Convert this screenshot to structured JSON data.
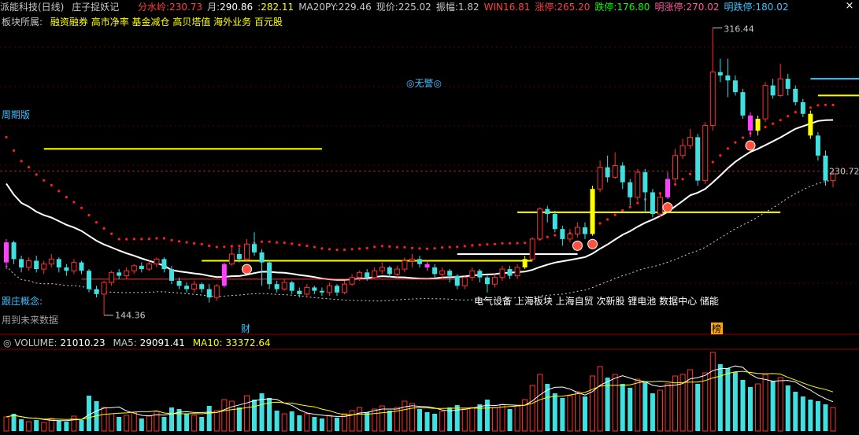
{
  "header": {
    "title": "派能科技(日线)",
    "indicator_name": "庄子捉妖记",
    "fields": [
      {
        "label": "分水岭:",
        "value": "230.73",
        "label_color": "#ff4040",
        "value_color": "#ff4040"
      },
      {
        "label": "月:",
        "value": "290.86",
        "label_color": "#c8c8c8",
        "value_color": "#ffffff"
      },
      {
        "label": ":",
        "value": "282.11",
        "label_color": "#c8c8c8",
        "value_color": "#ffff00"
      },
      {
        "label": "MA20PY:",
        "value": "229.46",
        "label_color": "#c8c8c8",
        "value_color": "#c8c8c8"
      },
      {
        "label": "现价:",
        "value": "225.02",
        "label_color": "#c8c8c8",
        "value_color": "#c8c8c8"
      },
      {
        "label": "振幅:",
        "value": "1.82",
        "label_color": "#c8c8c8",
        "value_color": "#c8c8c8"
      },
      {
        "label": "WIN",
        "value": "16.81",
        "label_color": "#ff4040",
        "value_color": "#ff4040"
      },
      {
        "label": "涨停:",
        "value": "265.20",
        "label_color": "#ff4040",
        "value_color": "#ff4040"
      },
      {
        "label": "跌停:",
        "value": "176.80",
        "label_color": "#00ff00",
        "value_color": "#00ff00"
      },
      {
        "label": "明涨停:",
        "value": "270.02",
        "label_color": "#ff5aa0",
        "value_color": "#ff5aa0"
      },
      {
        "label": "明跌停:",
        "value": "180.02",
        "label_color": "#40c0ff",
        "value_color": "#40c0ff"
      }
    ],
    "close_symbol": "×"
  },
  "boards": {
    "key": "板块所属:",
    "value": "融资融券 高市净率 基金减仓 高贝塔值 海外业务 百元股"
  },
  "side_labels": {
    "zhouqi": "周期版",
    "gen": "跟庄概念:",
    "future": "用到未来数据"
  },
  "alarm": "◎无警◎",
  "concepts": "电气设备 上海板块 上海自贸 次新股 锂电池 数据中心 储能",
  "markers": {
    "cai": "财",
    "bang": "榜"
  },
  "chart_data": {
    "type": "candlestick",
    "annotations": {
      "high_label": "316.44",
      "low_label": "144.36",
      "right_label": "230.72"
    },
    "volume": {
      "label": "VOLUME:",
      "value": "21010.23",
      "ma5_label": "MA5:",
      "ma5": "29091.41",
      "ma10_label": "MA10:",
      "ma10": "33372.64"
    },
    "candles": [
      {
        "o": 176,
        "c": 188,
        "h": 190,
        "l": 172
      },
      {
        "o": 188,
        "c": 178,
        "h": 189,
        "l": 175
      },
      {
        "o": 178,
        "c": 173,
        "h": 180,
        "l": 170
      },
      {
        "o": 173,
        "c": 177,
        "h": 179,
        "l": 171
      },
      {
        "o": 177,
        "c": 172,
        "h": 180,
        "l": 170
      },
      {
        "o": 172,
        "c": 175,
        "h": 177,
        "l": 169
      },
      {
        "o": 175,
        "c": 178,
        "h": 181,
        "l": 173
      },
      {
        "o": 178,
        "c": 173,
        "h": 179,
        "l": 170
      },
      {
        "o": 173,
        "c": 171,
        "h": 175,
        "l": 168
      },
      {
        "o": 171,
        "c": 176,
        "h": 178,
        "l": 169
      },
      {
        "o": 176,
        "c": 171,
        "h": 177,
        "l": 169
      },
      {
        "o": 171,
        "c": 160,
        "h": 172,
        "l": 158
      },
      {
        "o": 160,
        "c": 157,
        "h": 162,
        "l": 155
      },
      {
        "o": 157,
        "c": 164,
        "h": 165,
        "l": 144.36
      },
      {
        "o": 164,
        "c": 170,
        "h": 171,
        "l": 162
      },
      {
        "o": 170,
        "c": 168,
        "h": 172,
        "l": 166
      },
      {
        "o": 168,
        "c": 171,
        "h": 173,
        "l": 166
      },
      {
        "o": 171,
        "c": 174,
        "h": 175,
        "l": 169
      },
      {
        "o": 174,
        "c": 172,
        "h": 176,
        "l": 170
      },
      {
        "o": 172,
        "c": 175,
        "h": 177,
        "l": 171
      },
      {
        "o": 175,
        "c": 178,
        "h": 179,
        "l": 173
      },
      {
        "o": 178,
        "c": 172,
        "h": 179,
        "l": 170
      },
      {
        "o": 172,
        "c": 165,
        "h": 174,
        "l": 163
      },
      {
        "o": 165,
        "c": 162,
        "h": 167,
        "l": 160
      },
      {
        "o": 162,
        "c": 160,
        "h": 164,
        "l": 158
      },
      {
        "o": 160,
        "c": 163,
        "h": 165,
        "l": 158
      },
      {
        "o": 163,
        "c": 160,
        "h": 164,
        "l": 158
      },
      {
        "o": 160,
        "c": 155,
        "h": 163,
        "l": 152
      },
      {
        "o": 155,
        "c": 162,
        "h": 163,
        "l": 153
      },
      {
        "o": 162,
        "c": 175,
        "h": 176,
        "l": 161
      },
      {
        "o": 175,
        "c": 181,
        "h": 186,
        "l": 174
      },
      {
        "o": 181,
        "c": 178,
        "h": 185,
        "l": 176
      },
      {
        "o": 178,
        "c": 187,
        "h": 190,
        "l": 177
      },
      {
        "o": 187,
        "c": 182,
        "h": 194,
        "l": 180
      },
      {
        "o": 182,
        "c": 176,
        "h": 184,
        "l": 162
      },
      {
        "o": 176,
        "c": 163,
        "h": 177,
        "l": 160
      },
      {
        "o": 163,
        "c": 160,
        "h": 165,
        "l": 158
      },
      {
        "o": 160,
        "c": 164,
        "h": 166,
        "l": 159
      },
      {
        "o": 164,
        "c": 159,
        "h": 165,
        "l": 157
      },
      {
        "o": 159,
        "c": 157,
        "h": 161,
        "l": 155
      },
      {
        "o": 157,
        "c": 161,
        "h": 163,
        "l": 155
      },
      {
        "o": 161,
        "c": 159,
        "h": 162,
        "l": 157
      },
      {
        "o": 159,
        "c": 158,
        "h": 161,
        "l": 156
      },
      {
        "o": 158,
        "c": 162,
        "h": 164,
        "l": 156
      },
      {
        "o": 162,
        "c": 158,
        "h": 163,
        "l": 156
      },
      {
        "o": 158,
        "c": 163,
        "h": 165,
        "l": 157
      },
      {
        "o": 163,
        "c": 167,
        "h": 169,
        "l": 162
      },
      {
        "o": 167,
        "c": 170,
        "h": 171,
        "l": 165
      },
      {
        "o": 170,
        "c": 167,
        "h": 172,
        "l": 165
      },
      {
        "o": 167,
        "c": 171,
        "h": 173,
        "l": 166
      },
      {
        "o": 171,
        "c": 173,
        "h": 176,
        "l": 169
      },
      {
        "o": 173,
        "c": 169,
        "h": 174,
        "l": 167
      },
      {
        "o": 169,
        "c": 172,
        "h": 174,
        "l": 167
      },
      {
        "o": 172,
        "c": 177,
        "h": 179,
        "l": 170
      },
      {
        "o": 177,
        "c": 178,
        "h": 181,
        "l": 173
      },
      {
        "o": 178,
        "c": 175,
        "h": 180,
        "l": 173
      },
      {
        "o": 175,
        "c": 173,
        "h": 177,
        "l": 171
      },
      {
        "o": 173,
        "c": 169,
        "h": 175,
        "l": 167
      },
      {
        "o": 169,
        "c": 171,
        "h": 173,
        "l": 166
      },
      {
        "o": 171,
        "c": 168,
        "h": 172,
        "l": 164
      },
      {
        "o": 168,
        "c": 162,
        "h": 169,
        "l": 160
      },
      {
        "o": 162,
        "c": 167,
        "h": 168,
        "l": 160
      },
      {
        "o": 167,
        "c": 171,
        "h": 173,
        "l": 165
      },
      {
        "o": 171,
        "c": 167,
        "h": 172,
        "l": 164
      },
      {
        "o": 167,
        "c": 163,
        "h": 168,
        "l": 158
      },
      {
        "o": 163,
        "c": 167,
        "h": 169,
        "l": 161
      },
      {
        "o": 167,
        "c": 172,
        "h": 174,
        "l": 165
      },
      {
        "o": 172,
        "c": 168,
        "h": 174,
        "l": 166
      },
      {
        "o": 168,
        "c": 173,
        "h": 175,
        "l": 166
      },
      {
        "o": 173,
        "c": 178,
        "h": 180,
        "l": 172
      },
      {
        "o": 178,
        "c": 190,
        "h": 191,
        "l": 177
      },
      {
        "o": 190,
        "c": 208,
        "h": 209,
        "l": 189
      },
      {
        "o": 208,
        "c": 205,
        "h": 210,
        "l": 200
      },
      {
        "o": 205,
        "c": 196,
        "h": 207,
        "l": 194
      },
      {
        "o": 196,
        "c": 190,
        "h": 198,
        "l": 186
      },
      {
        "o": 190,
        "c": 193,
        "h": 196,
        "l": 188
      },
      {
        "o": 193,
        "c": 197,
        "h": 200,
        "l": 191
      },
      {
        "o": 197,
        "c": 193,
        "h": 200,
        "l": 190
      },
      {
        "o": 193,
        "c": 220,
        "h": 222,
        "l": 192
      },
      {
        "o": 220,
        "c": 233,
        "h": 237,
        "l": 218
      },
      {
        "o": 233,
        "c": 227,
        "h": 240,
        "l": 224
      },
      {
        "o": 227,
        "c": 234,
        "h": 242,
        "l": 226
      },
      {
        "o": 234,
        "c": 224,
        "h": 236,
        "l": 220
      },
      {
        "o": 224,
        "c": 215,
        "h": 226,
        "l": 210
      },
      {
        "o": 215,
        "c": 230,
        "h": 232,
        "l": 213
      },
      {
        "o": 230,
        "c": 218,
        "h": 232,
        "l": 206
      },
      {
        "o": 218,
        "c": 205,
        "h": 220,
        "l": 203
      },
      {
        "o": 205,
        "c": 215,
        "h": 218,
        "l": 203
      },
      {
        "o": 215,
        "c": 226,
        "h": 230,
        "l": 214
      },
      {
        "o": 226,
        "c": 240,
        "h": 244,
        "l": 224
      },
      {
        "o": 240,
        "c": 246,
        "h": 250,
        "l": 238
      },
      {
        "o": 246,
        "c": 251,
        "h": 256,
        "l": 244
      },
      {
        "o": 251,
        "c": 225,
        "h": 253,
        "l": 222
      },
      {
        "o": 225,
        "c": 258,
        "h": 260,
        "l": 223
      },
      {
        "o": 258,
        "c": 290,
        "h": 316.44,
        "l": 255
      },
      {
        "o": 290,
        "c": 288,
        "h": 298,
        "l": 284
      },
      {
        "o": 288,
        "c": 285,
        "h": 298,
        "l": 275
      },
      {
        "o": 285,
        "c": 278,
        "h": 288,
        "l": 276
      },
      {
        "o": 278,
        "c": 264,
        "h": 280,
        "l": 262
      },
      {
        "o": 264,
        "c": 255,
        "h": 266,
        "l": 251
      },
      {
        "o": 255,
        "c": 262,
        "h": 264,
        "l": 252
      },
      {
        "o": 262,
        "c": 282,
        "h": 284,
        "l": 260
      },
      {
        "o": 282,
        "c": 276,
        "h": 286,
        "l": 274
      },
      {
        "o": 276,
        "c": 286,
        "h": 295,
        "l": 275
      },
      {
        "o": 286,
        "c": 280,
        "h": 289,
        "l": 276
      },
      {
        "o": 280,
        "c": 272,
        "h": 282,
        "l": 270
      },
      {
        "o": 272,
        "c": 265,
        "h": 274,
        "l": 263
      },
      {
        "o": 265,
        "c": 252,
        "h": 267,
        "l": 250
      },
      {
        "o": 252,
        "c": 240,
        "h": 254,
        "l": 237
      },
      {
        "o": 240,
        "c": 225,
        "h": 243,
        "l": 222
      },
      {
        "o": 225,
        "c": 229,
        "h": 232,
        "l": 221
      }
    ],
    "volumes": [
      18,
      22,
      15,
      12,
      14,
      11,
      16,
      13,
      12,
      19,
      14,
      45,
      38,
      30,
      22,
      18,
      20,
      24,
      16,
      19,
      25,
      18,
      30,
      28,
      22,
      20,
      18,
      32,
      26,
      40,
      38,
      30,
      45,
      40,
      48,
      42,
      26,
      22,
      25,
      20,
      22,
      18,
      16,
      20,
      17,
      22,
      26,
      30,
      24,
      28,
      32,
      26,
      30,
      38,
      35,
      28,
      24,
      22,
      25,
      30,
      33,
      28,
      30,
      34,
      40,
      30,
      34,
      28,
      32,
      40,
      58,
      72,
      60,
      48,
      42,
      45,
      50,
      44,
      70,
      82,
      68,
      72,
      60,
      55,
      66,
      62,
      48,
      52,
      60,
      70,
      72,
      78,
      60,
      74,
      100,
      85,
      80,
      75,
      65,
      56,
      60,
      72,
      64,
      68,
      58,
      50,
      44,
      40,
      38,
      34,
      30
    ],
    "price_axis": {
      "min": 140,
      "max": 320
    }
  }
}
